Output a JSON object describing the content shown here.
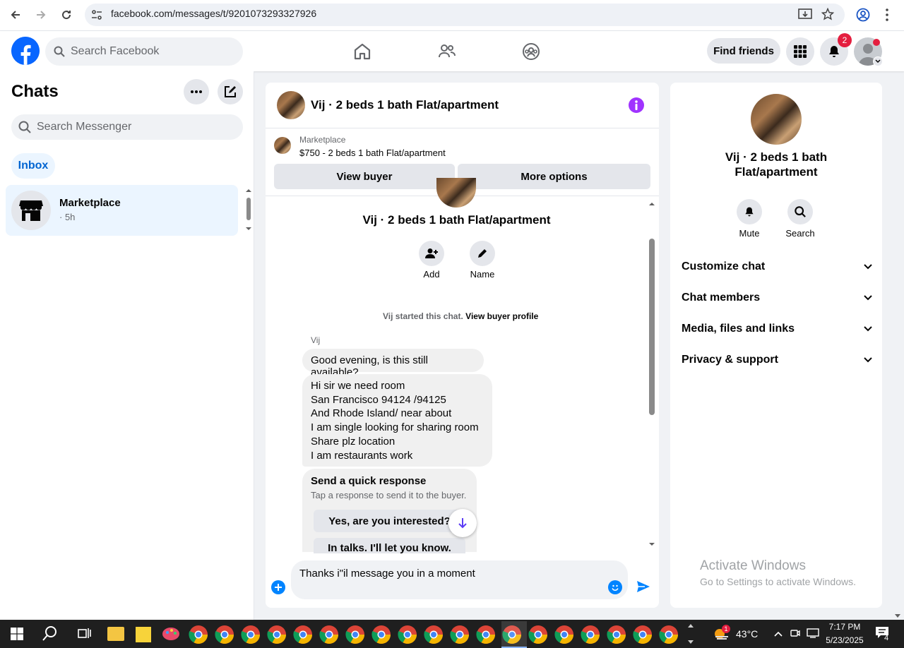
{
  "browser": {
    "url": "facebook.com/messages/t/9201073293327926"
  },
  "fb": {
    "search_placeholder": "Search Facebook",
    "find_friends": "Find friends",
    "notification_count": "2"
  },
  "left": {
    "title": "Chats",
    "search_placeholder": "Search Messenger",
    "inbox_label": "Inbox",
    "chat": {
      "name": "Marketplace",
      "time": "· 5h"
    }
  },
  "chat": {
    "title": "Vij · 2 beds 1 bath Flat/apartment",
    "marketplace_label": "Marketplace",
    "listing": "$750 - 2 beds 1 bath Flat/apartment",
    "view_buyer": "View buyer",
    "more_options": "More options",
    "profile_name": "Vij · 2 beds 1 bath Flat/apartment",
    "add_label": "Add",
    "name_label": "Name",
    "started_text": "Vij started this chat.",
    "view_buyer_profile": "View buyer profile",
    "sender": "Vij",
    "messages": [
      "Good evening, is this still available?",
      "Hi sir we need room",
      "San Francisco 94124 /94125",
      "And Rhode Island/ near about",
      "I am single  looking for sharing room",
      "Share plz location",
      "I am restaurants work"
    ],
    "quick_title": "Send a quick response",
    "quick_sub": "Tap a response to send it to the buyer.",
    "quick_1": "Yes, are you interested?",
    "quick_2": "In talks. I'll let you know.",
    "composer_text": "Thanks i\"il message you in a moment"
  },
  "right": {
    "name": "Vij · 2 beds 1 bath Flat/apartment",
    "mute": "Mute",
    "search": "Search",
    "rows": [
      "Customize chat",
      "Chat members",
      "Media, files and links",
      "Privacy & support"
    ],
    "watermark_title": "Activate Windows",
    "watermark_sub": "Go to Settings to activate Windows."
  },
  "taskbar": {
    "temperature": "43°C",
    "time": "7:17 PM",
    "date": "5/23/2025",
    "weather_badge": "1",
    "notif_count": "4"
  },
  "colors": {
    "fb_blue": "#0866ff",
    "accent_link": "#0064d1",
    "info_purple": "#a033ff",
    "send_blue": "#0084ff"
  }
}
